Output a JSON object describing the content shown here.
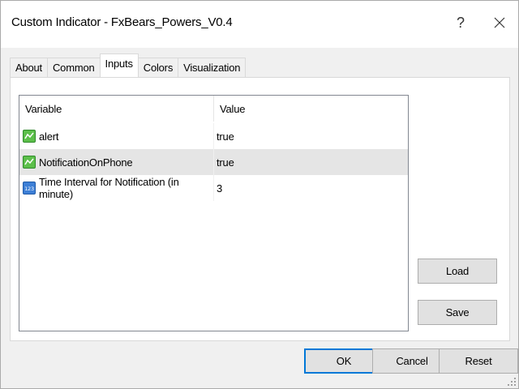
{
  "window": {
    "title": "Custom Indicator - FxBears_Powers_V0.4",
    "help_label": "?",
    "close_icon": "close-icon"
  },
  "tabs": [
    {
      "label": "About",
      "active": false
    },
    {
      "label": "Common",
      "active": false
    },
    {
      "label": "Inputs",
      "active": true
    },
    {
      "label": "Colors",
      "active": false
    },
    {
      "label": "Visualization",
      "active": false
    }
  ],
  "inputs_table": {
    "headers": {
      "variable": "Variable",
      "value": "Value"
    },
    "rows": [
      {
        "variable": "alert",
        "value": "true",
        "icon": "boolean-icon",
        "selected": false
      },
      {
        "variable": "NotificationOnPhone",
        "value": "true",
        "icon": "boolean-icon",
        "selected": true
      },
      {
        "variable": "Time Interval for Notification (in minute)",
        "value": "3",
        "icon": "integer-icon",
        "selected": false
      }
    ]
  },
  "side_buttons": {
    "load": "Load",
    "save": "Save"
  },
  "footer_buttons": {
    "ok": "OK",
    "cancel": "Cancel",
    "reset": "Reset"
  },
  "colors": {
    "accent": "#0078d7",
    "selected_row": "#e5e5e5"
  }
}
